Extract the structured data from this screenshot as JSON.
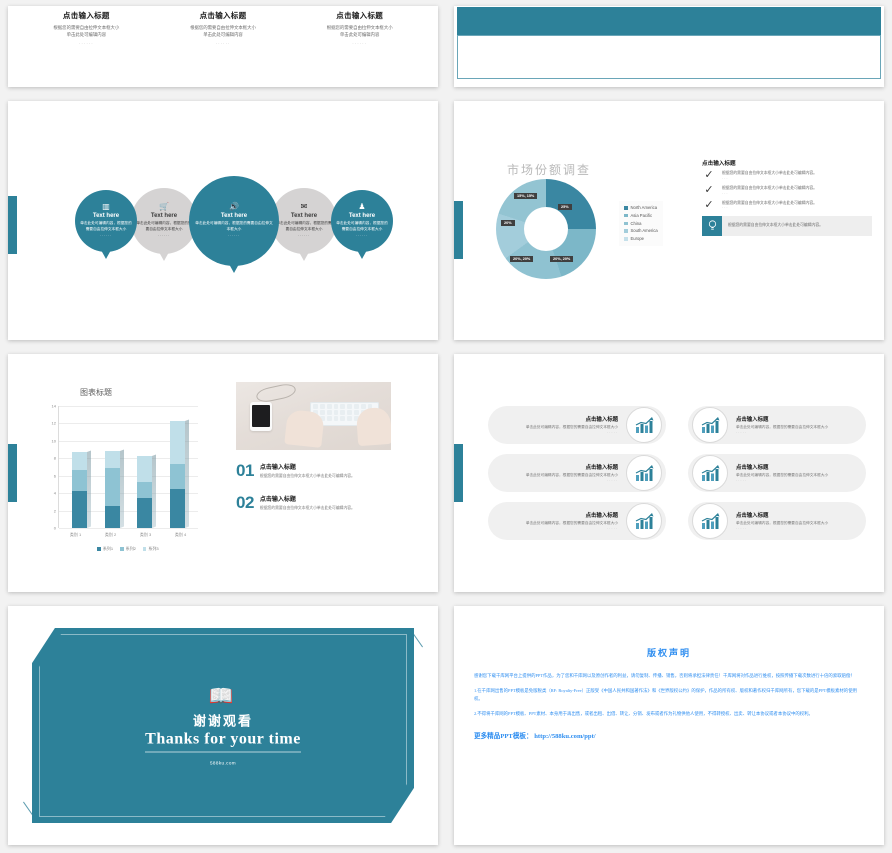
{
  "theme": {
    "teal": "#2d8199",
    "gray_bubble": "#d5d3d3",
    "blue_text": "#2f8ef0"
  },
  "slide1": {
    "columns": [
      {
        "title": "点击输入标题",
        "body": "根据您的需要自由拉伸文本框大小\n单击此处可编辑内容",
        "dots": "······"
      },
      {
        "title": "点击输入标题",
        "body": "根据您的需要自由拉伸文本框大小\n单击此处可编辑内容",
        "dots": "······"
      },
      {
        "title": "点击输入标题",
        "body": "根据您的需要自由拉伸文本框大小\n单击此处可编辑内容",
        "dots": "······"
      }
    ]
  },
  "slide2": {
    "band_color": "#2d8199"
  },
  "slide3": {
    "bubbles": [
      {
        "icon": "▥",
        "icon_name": "bar-chart-icon",
        "title": "Text here",
        "body": "单击此处可编辑内容，根据您的需要自由拉伸文本框大小",
        "dots": "······",
        "style": "teal"
      },
      {
        "icon": "🛒",
        "icon_name": "shopping-cart-icon",
        "title": "Text here",
        "body": "单击此处可编辑内容，根据您的需要自由拉伸文本框大小",
        "dots": "······",
        "style": "gray"
      },
      {
        "icon": "🔊",
        "icon_name": "megaphone-icon",
        "title": "Text here",
        "body": "单击此处可编辑内容，根据您的需要自由拉伸文本框大小",
        "dots": "······",
        "style": "teal"
      },
      {
        "icon": "✉",
        "icon_name": "envelope-icon",
        "title": "Text here",
        "body": "单击此处可编辑内容，根据您的需要自由拉伸文本框大小",
        "dots": "······",
        "style": "gray"
      },
      {
        "icon": "♟",
        "icon_name": "bell-icon",
        "title": "Text here",
        "body": "单击此处可编辑内容，根据您的需要自由拉伸文本框大小",
        "dots": "······",
        "style": "teal"
      }
    ]
  },
  "slide4": {
    "title": "市场份额调查",
    "right_title": "点击输入标题",
    "checks": [
      {
        "icon": "✓",
        "text": "根据您的需要自由拉伸文本框大小单击此处可编辑内容。",
        "dots": "···"
      },
      {
        "icon": "✓",
        "text": "根据您的需要自由拉伸文本框大小单击此处可编辑内容。",
        "dots": "···"
      },
      {
        "icon": "✓",
        "text": "根据您的需要自由拉伸文本框大小单击此处可编辑内容。",
        "dots": "···"
      }
    ],
    "highlight": {
      "icon": "💡",
      "text": "根据您的需要自由拉伸文本框大小单击此处可编辑内容。"
    },
    "chart_data": {
      "type": "pie",
      "title": "市场份额调查",
      "labels": [
        "North America",
        "Asia Pacific",
        "China",
        "South America",
        "Europe"
      ],
      "values": [
        25,
        20,
        20,
        15,
        20
      ],
      "data_labels": [
        "25%",
        "20%, 20%",
        "20%, 20%",
        "15%, 15%",
        "20%"
      ],
      "colors": [
        "#3a87a2",
        "#7cb7c8",
        "#8fc2d1",
        "#a3cddb",
        "#93c4d2"
      ],
      "legend_position": "right",
      "donut": true
    }
  },
  "slide5": {
    "number_items": [
      {
        "num": "01",
        "title": "点击输入标题",
        "body": "根据您的需要自由拉伸文本框大小单击此处可编辑内容。"
      },
      {
        "num": "02",
        "title": "点击输入标题",
        "body": "根据您的需要自由拉伸文本框大小单击此处可编辑内容。"
      }
    ],
    "chart_data": {
      "type": "bar",
      "title": "图表标题",
      "categories": [
        "类别 1",
        "类别 2",
        "类别 3",
        "类别 4"
      ],
      "series": [
        {
          "name": "系列1",
          "values": [
            4.3,
            2.5,
            3.5,
            4.5
          ],
          "color": "#3a87a2"
        },
        {
          "name": "系列2",
          "values": [
            2.4,
            4.4,
            1.8,
            2.8
          ],
          "color": "#8ec3d3"
        },
        {
          "name": "系列3",
          "values": [
            2.0,
            2.0,
            3.0,
            5.0
          ],
          "color": "#c0dfe9"
        }
      ],
      "stacked": true,
      "ylim": [
        0,
        14
      ],
      "yticks": [
        0,
        2,
        4,
        6,
        8,
        10,
        12,
        14
      ],
      "xlabel": "",
      "ylabel": "",
      "grid": true,
      "legend_position": "bottom"
    }
  },
  "slide6": {
    "items": [
      {
        "icon_name": "growth-chart-icon",
        "title": "点击输入标题",
        "body": "单击此处可编辑内容，根据您的需要自由拉伸文本框大小",
        "dots": "·····",
        "side": "left"
      },
      {
        "icon_name": "growth-chart-icon",
        "title": "点击输入标题",
        "body": "单击此处可编辑内容，根据您的需要自由拉伸文本框大小",
        "dots": "·····",
        "side": "right"
      },
      {
        "icon_name": "growth-chart-icon",
        "title": "点击输入标题",
        "body": "单击此处可编辑内容，根据您的需要自由拉伸文本框大小",
        "dots": "·····",
        "side": "left"
      },
      {
        "icon_name": "growth-chart-icon",
        "title": "点击输入标题",
        "body": "单击此处可编辑内容，根据您的需要自由拉伸文本框大小",
        "dots": "·····",
        "side": "right"
      },
      {
        "icon_name": "growth-chart-icon",
        "title": "点击输入标题",
        "body": "单击此处可编辑内容，根据您的需要自由拉伸文本框大小",
        "dots": "·····",
        "side": "left"
      },
      {
        "icon_name": "growth-chart-icon",
        "title": "点击输入标题",
        "body": "单击此处可编辑内容，根据您的需要自由拉伸文本框大小",
        "dots": "·····",
        "side": "right"
      }
    ]
  },
  "slide7": {
    "icon": "📖",
    "title_cn": "谢谢观看",
    "title_en": "Thanks for your time",
    "url": "588ku.com"
  },
  "slide8": {
    "title": "版权声明",
    "paragraphs": [
      "感谢您下载千库网平台上提供的PPT作品，为了您和千库网以及原创作者的利益，请勿复制、传播、销售，否则将承担法律责任！千库网将对作品进行维权，按照传播下载次数进行十倍的索取赔偿！",
      "1.在千库网出售的PPT模板是免版税类（RF: Royalty-Free）正版受《中国人民共和国著作法》和《世界版权公约》的保护，作品的所有权、版权和著作权归千库网所有，您下载的是PPT模板素材的使用权。",
      "2.不得将千库网的PPT模板、PPT素材、本身用于再出售，或者出租、出借、转让、分销、发布或者作为礼物供他人使用，不得转授权、出卖、转让本协议或者本协议中的权利。"
    ],
    "link": "更多精品PPT模板： http://588ku.com/ppt/"
  }
}
